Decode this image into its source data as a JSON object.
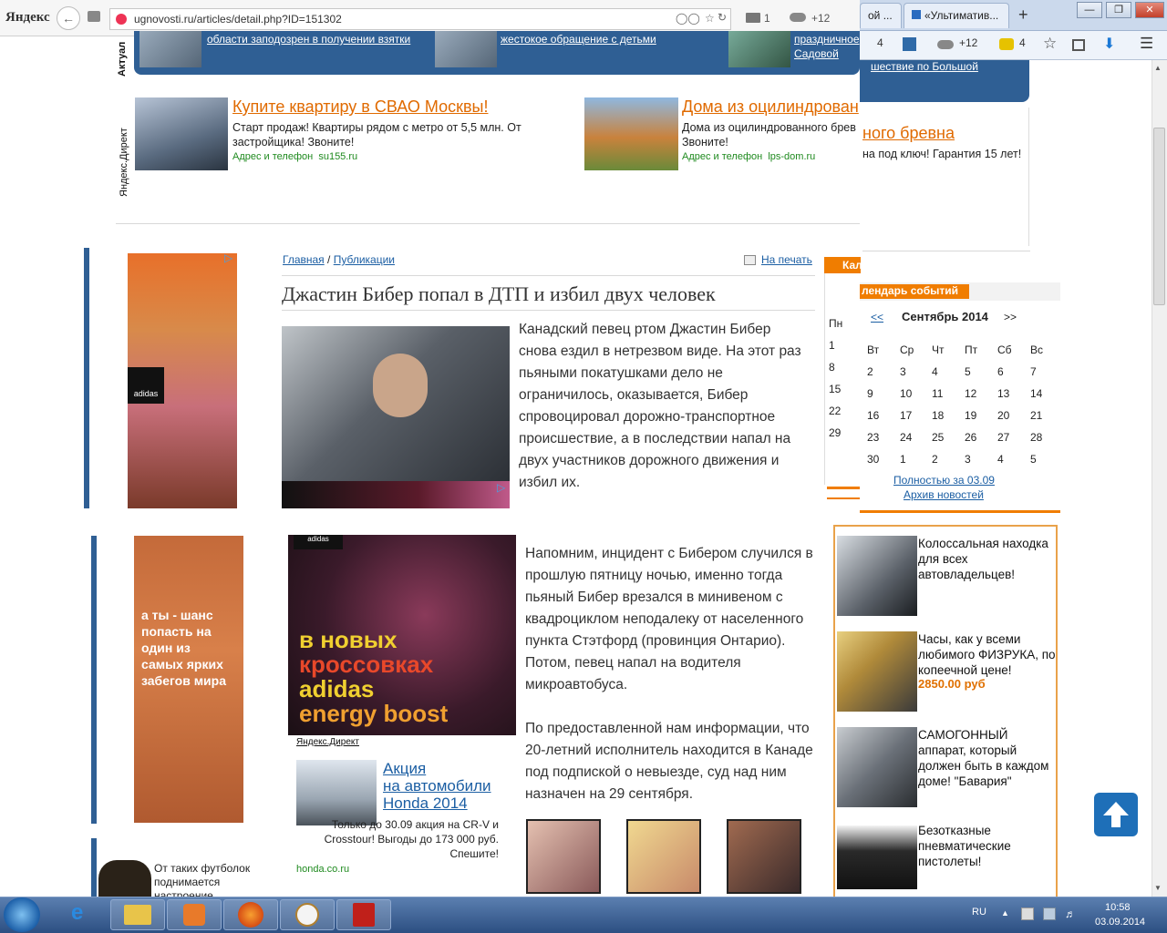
{
  "yandex_bar": {
    "logo": "Яндекс",
    "url": "ugnovosti.ru/articles/detail.php?ID=151302",
    "mail_count": "1",
    "weather": "+12"
  },
  "firefox": {
    "tab1": "ой ...",
    "tab2": "«Ультиматив...",
    "new_tab": "+",
    "tool_count1": "4",
    "tool_weather": "+12",
    "tool_count2": "4"
  },
  "top_strip": {
    "label": "Актуал",
    "item1": "области заподозрен в получении взятки",
    "item2": "жестокое обращение с детьми",
    "item3a": "праздничное",
    "item3b": "Садовой",
    "item4": "шествие по Большой"
  },
  "direct": {
    "label": "Яндекс.Директ",
    "ad1_title": "Купите квартиру в СВАО Москвы!",
    "ad1_text": "Старт продаж! Квартиры рядом с метро от 5,5 млн. От застройщика! Звоните!",
    "ad1_addr": "Адрес и телефон",
    "ad1_site": "su155.ru",
    "ad2_title": "Дома из оцилиндрован",
    "ad2_title_rest": "ного бревна",
    "ad2_text": "Дома из оцилиндрованного брев",
    "ad2_text2": "Звоните!",
    "ad2_text_rest": "на под ключ! Гарантия 15 лет!",
    "ad2_addr": "Адрес и телефон",
    "ad2_site": "lps-dom.ru"
  },
  "article": {
    "crumb_home": "Главная",
    "crumb_sep": "/",
    "crumb_pub": "Публикации",
    "print": "На печать",
    "title": "Джастин Бибер попал в ДТП и избил двух человек",
    "para1": "Канадский певец ртом Джастин Бибер снова ездил в нетрезвом виде. На этот раз пьяными покатушками дело не ограничилось, оказывается, Бибер спровоцировал дорожно-транспортное происшествие, а в последствии напал на двух участников дорожного движения и избил их.",
    "para2": "Напомним, инцидент с Бибером случился в прошлую пятницу ночью, именно тогда пьяный Бибер врезался в минивеном с квадроциклом неподалеку от населенного пункта Стэтфорд (провинция Онтарио). Потом, певец напал на водителя микроавтобуса.",
    "para3": "По предоставленной нам информации, что 20-летний исполнитель находится в Канаде под подпиской о невыезде, суд над ним назначен на 29 сентября."
  },
  "ads_left": {
    "adidas": "adidas",
    "banner_text": "а ты - шанс попасть на один из самых ярких забегов мира",
    "tshirt_text": "От таких футболок поднимается настроение"
  },
  "adidas_big": {
    "brand": "adidas",
    "line1": "в новых",
    "line2": "кроссовках",
    "line3": "adidas",
    "line4": "energy boost",
    "direct_label": "Яндекс.Директ"
  },
  "honda_ad": {
    "title1": "Акция",
    "title2": "на автомобили",
    "title3": "Honda 2014",
    "text": "Только до 30.09 акция на CR-V и Crosstour! Выгоды до 173 000 руб. Спешите!",
    "site": "honda.co.ru"
  },
  "calendar": {
    "kal": "Кал",
    "header": "лендарь событий",
    "prev": "<<",
    "month": "Сентябрь 2014",
    "next": ">>",
    "weekdays": [
      "Пн",
      "Вт",
      "Ср",
      "Чт",
      "Пт",
      "Сб",
      "Вс"
    ],
    "weeks": [
      [
        "1",
        "2",
        "3",
        "4",
        "5",
        "6",
        "7"
      ],
      [
        "8",
        "9",
        "10",
        "11",
        "12",
        "13",
        "14"
      ],
      [
        "15",
        "16",
        "17",
        "18",
        "19",
        "20",
        "21"
      ],
      [
        "22",
        "23",
        "24",
        "25",
        "26",
        "27",
        "28"
      ],
      [
        "29",
        "30",
        "1",
        "2",
        "3",
        "4",
        "5"
      ]
    ],
    "full_link": "Полностью за 03.09",
    "archive": "Архив новостей"
  },
  "side_news": [
    {
      "text": "Колоссальная находка для всех автовладельцев!",
      "price": ""
    },
    {
      "text": "Часы, как у всеми любимого ФИЗРУКА, по копеечной цене!",
      "price": "2850.00 руб"
    },
    {
      "text": "САМОГОННЫЙ аппарат, который должен быть в каждом доме! \"Бавария\"",
      "price": ""
    },
    {
      "text": "Безотказные пневматические пистолеты!",
      "price": ""
    }
  ],
  "taskbar": {
    "lang": "RU",
    "time": "10:58",
    "date": "03.09.2014"
  }
}
